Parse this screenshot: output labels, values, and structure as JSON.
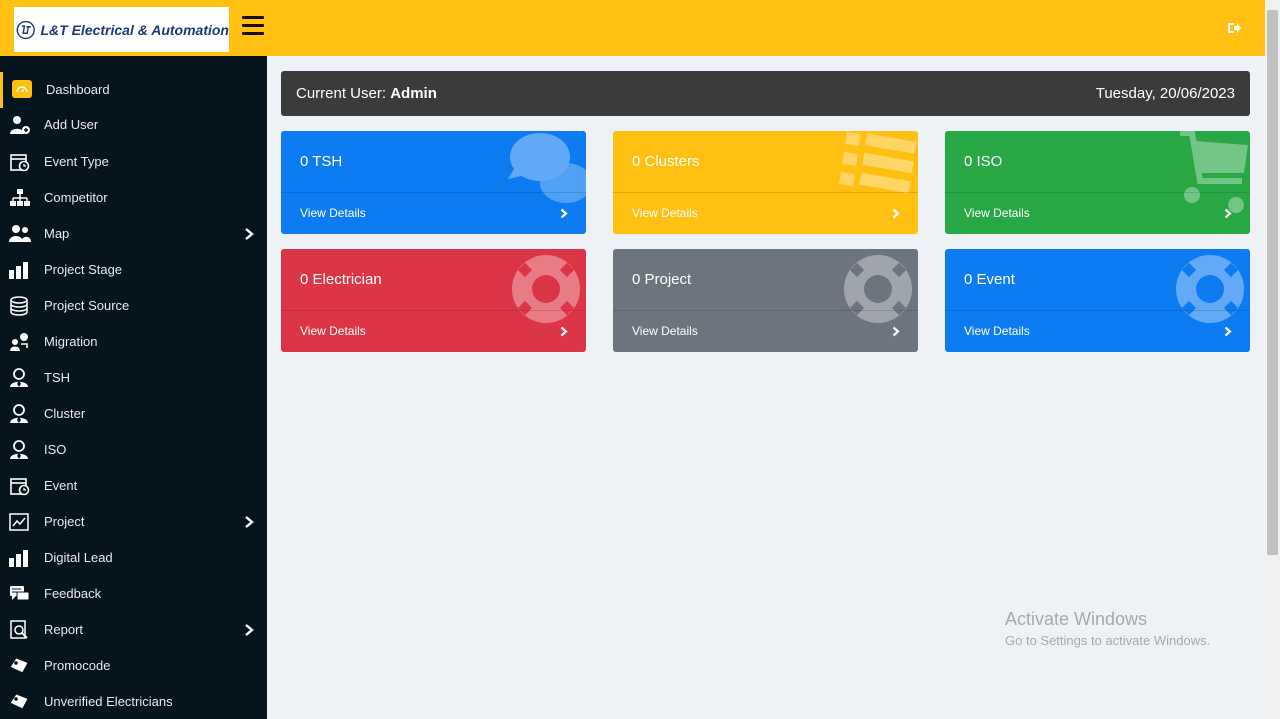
{
  "header": {
    "logo_text": "L&T Electrical & Automation",
    "brand_color": "#ffc011"
  },
  "sidebar": {
    "items": [
      {
        "label": "Dashboard",
        "icon": "dashboard-icon",
        "active": true
      },
      {
        "label": "Add User",
        "icon": "add-user-icon"
      },
      {
        "label": "Event Type",
        "icon": "calendar-clock-icon"
      },
      {
        "label": "Competitor",
        "icon": "sitemap-icon"
      },
      {
        "label": "Map",
        "icon": "users-icon",
        "has_submenu": true
      },
      {
        "label": "Project Stage",
        "icon": "bar-chart-icon"
      },
      {
        "label": "Project Source",
        "icon": "database-icon"
      },
      {
        "label": "Migration",
        "icon": "migration-icon"
      },
      {
        "label": "TSH",
        "icon": "user-tie-icon"
      },
      {
        "label": "Cluster",
        "icon": "user-tie-icon"
      },
      {
        "label": "ISO",
        "icon": "user-tie-icon"
      },
      {
        "label": "Event",
        "icon": "calendar-clock-icon"
      },
      {
        "label": "Project",
        "icon": "chart-window-icon",
        "has_submenu": true
      },
      {
        "label": "Digital Lead",
        "icon": "bar-chart-icon"
      },
      {
        "label": "Feedback",
        "icon": "comments-icon"
      },
      {
        "label": "Report",
        "icon": "report-search-icon",
        "has_submenu": true
      },
      {
        "label": "Promocode",
        "icon": "tag-icon"
      },
      {
        "label": "Unverified Electricians",
        "icon": "tag-icon"
      }
    ]
  },
  "userbar": {
    "prefix": "Current User: ",
    "user": "Admin",
    "date": "Tuesday, 20/06/2023"
  },
  "cards": [
    {
      "title": "0 TSH",
      "link": "View Details",
      "color": "#0d7cf2",
      "icon": "comments-icon"
    },
    {
      "title": "0 Clusters",
      "link": "View Details",
      "color": "#ffc011",
      "icon": "list-icon"
    },
    {
      "title": "0 ISO",
      "link": "View Details",
      "color": "#28a745",
      "icon": "shopping-cart-icon"
    },
    {
      "title": "0 Electrician",
      "link": "View Details",
      "color": "#dc3545",
      "icon": "life-ring-icon"
    },
    {
      "title": "0 Project",
      "link": "View Details",
      "color": "#6c757d",
      "icon": "life-ring-icon"
    },
    {
      "title": "0 Event",
      "link": "View Details",
      "color": "#0d7cf2",
      "icon": "life-ring-icon"
    }
  ],
  "watermark": {
    "line1": "Activate Windows",
    "line2": "Go to Settings to activate Windows."
  }
}
